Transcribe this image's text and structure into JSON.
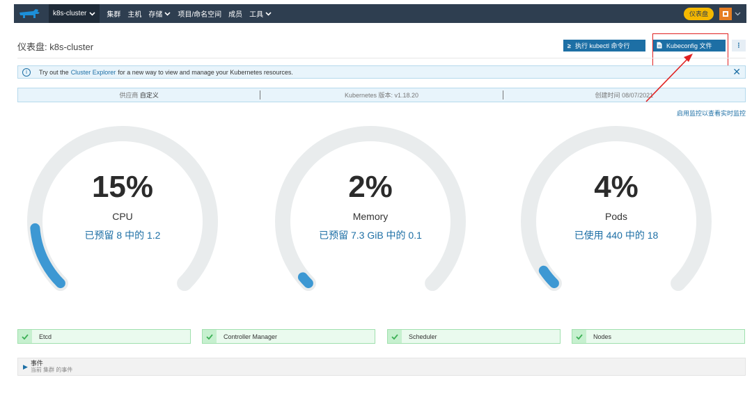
{
  "nav": {
    "cluster": "k8s-cluster",
    "items": [
      {
        "label": "集群",
        "dropdown": false
      },
      {
        "label": "主机",
        "dropdown": false
      },
      {
        "label": "存储",
        "dropdown": true
      },
      {
        "label": "项目/命名空间",
        "dropdown": false
      },
      {
        "label": "成员",
        "dropdown": false
      },
      {
        "label": "工具",
        "dropdown": true
      }
    ],
    "dashboard_pill": "仪表盘"
  },
  "page": {
    "title": "仪表盘: k8s-cluster",
    "kubectl_button": "执行 kubectl 命令行",
    "kubeconfig_button": "Kubeconfig 文件",
    "more_button": "⋮"
  },
  "banner": {
    "prefix": "Try out the",
    "link": "Cluster Explorer",
    "suffix": "for a new way to view and manage your Kubernetes resources."
  },
  "infobar": {
    "provider_label": "供应商",
    "provider_value": "自定义",
    "k8s_label": "Kubernetes 版本:",
    "k8s_value": "v1.18.20",
    "created_label": "创建时间",
    "created_value": "08/07/2021"
  },
  "monitor_link": "启用监控以查看实时监控",
  "gauges": [
    {
      "percent": "15%",
      "label": "CPU",
      "detail": "已预留 8 中的 1.2",
      "fraction": 0.15
    },
    {
      "percent": "2%",
      "label": "Memory",
      "detail": "已预留 7.3 GiB 中的 0.1",
      "fraction": 0.02
    },
    {
      "percent": "4%",
      "label": "Pods",
      "detail": "已使用 440 中的 18",
      "fraction": 0.04
    }
  ],
  "status": [
    {
      "label": "Etcd"
    },
    {
      "label": "Controller Manager"
    },
    {
      "label": "Scheduler"
    },
    {
      "label": "Nodes"
    }
  ],
  "events": {
    "title": "事件",
    "subtitle": "当前 集群 的事件"
  },
  "colors": {
    "nav_bg": "#2e3e50",
    "accent": "#1d6fa5",
    "gauge_track": "#e9eced",
    "gauge_fill": "#3d98d3",
    "ok_green": "#3cb055",
    "highlight_red": "#e02020"
  }
}
